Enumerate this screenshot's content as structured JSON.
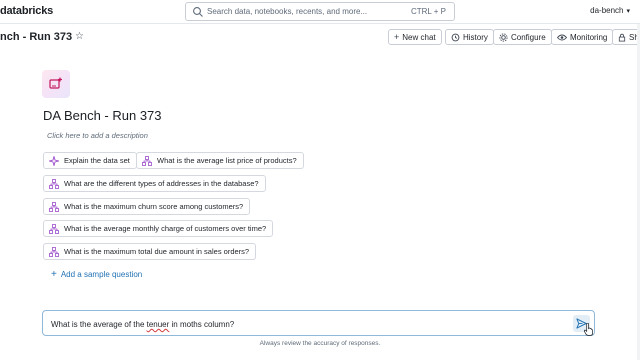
{
  "topbar": {
    "logo": "databricks",
    "search_placeholder": "Search data, notebooks, recents, and more...",
    "search_shortcut": "CTRL + P",
    "workspace": "da-bench",
    "workspace_chevron": "chevron-down-icon"
  },
  "header": {
    "title": "nch - Run 373",
    "star_icon": "star-icon",
    "buttons": {
      "new_chat": "New chat",
      "history": "History",
      "configure": "Configure",
      "monitoring": "Monitoring",
      "share": "Sha"
    }
  },
  "space": {
    "title": "DA Bench - Run 373",
    "description_placeholder": "Click here to add a description",
    "icon_colors": {
      "bg_start": "#fde7ef",
      "bg_end": "#e9e6fb",
      "accent": "#c2185b"
    }
  },
  "suggestions": [
    {
      "label": "Explain the data set",
      "icon": "sparkle-icon"
    },
    {
      "label": "What is the average list price of products?",
      "icon": "hierarchy-icon"
    },
    {
      "label": "What are the different types of addresses in the database?",
      "icon": "hierarchy-icon"
    },
    {
      "label": "What is the maximum churn score among customers?",
      "icon": "hierarchy-icon"
    },
    {
      "label": "What is the average monthly charge of customers over time?",
      "icon": "hierarchy-icon"
    },
    {
      "label": "What is the maximum total due amount in sales orders?",
      "icon": "hierarchy-icon"
    }
  ],
  "add_sample_question": "Add a sample question",
  "composer": {
    "text_before": "What is the average of the ",
    "text_typo": "tenuer",
    "text_after": " in moths column?",
    "send_icon": "send-icon"
  },
  "footnote": "Always review the accuracy of responses.",
  "colors": {
    "link": "#2272b4",
    "composer_border": "#8fb8d9",
    "hierarchy_icon": "#9b4dca",
    "sparkle_icon": "#9b4dca"
  }
}
